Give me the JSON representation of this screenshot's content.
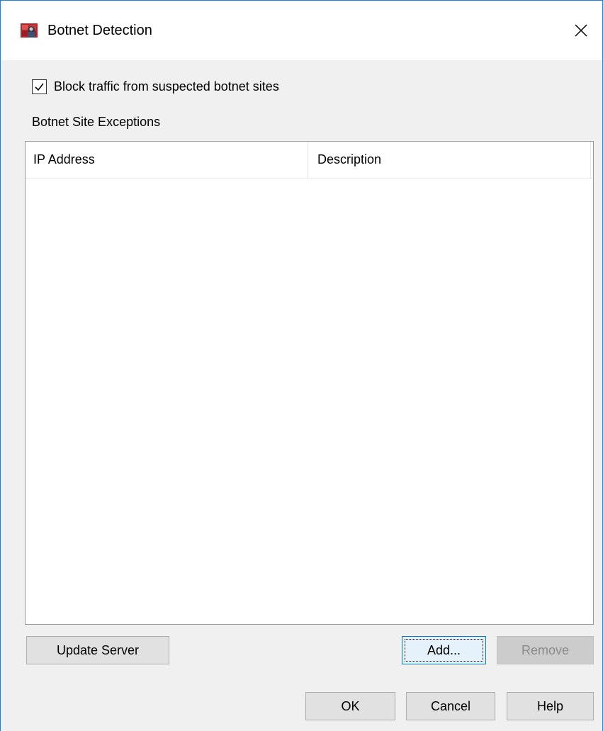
{
  "window": {
    "title": "Botnet Detection",
    "app_icon": "firewall-app-icon",
    "close_icon": "close-icon"
  },
  "options": {
    "block_traffic_label": "Block traffic from suspected botnet sites",
    "block_traffic_checked": true
  },
  "exceptions": {
    "section_label": "Botnet Site Exceptions",
    "columns": [
      "IP Address",
      "Description"
    ],
    "rows": []
  },
  "buttons": {
    "update_server": "Update Server",
    "add": "Add...",
    "remove": "Remove",
    "ok": "OK",
    "cancel": "Cancel",
    "help": "Help"
  },
  "colors": {
    "window_border": "#1883d7",
    "focused_button_border": "#0078d7",
    "disabled_text": "#8a8a8a"
  }
}
